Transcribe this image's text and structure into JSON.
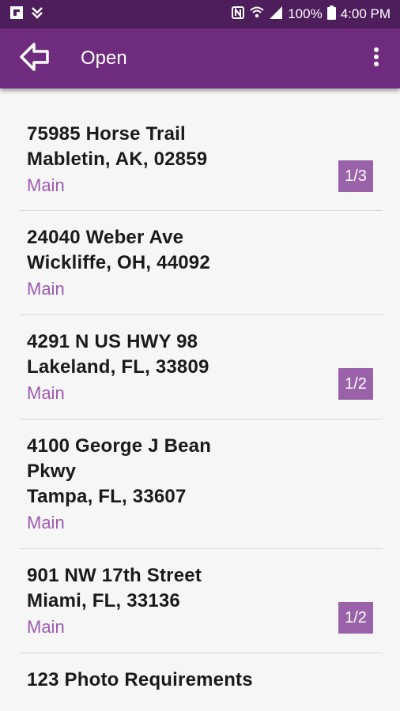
{
  "status_bar": {
    "battery": "100%",
    "time": "4:00 PM",
    "icons": [
      "flipboard-icon",
      "download-icon",
      "nfc-icon",
      "wifi-icon",
      "signal-icon",
      "battery-icon"
    ]
  },
  "app_bar": {
    "title": "Open",
    "back_icon": "back-arrow-icon",
    "menu_icon": "overflow-menu-icon"
  },
  "colors": {
    "status_bar": "#4e1d5c",
    "app_bar": "#6f2b7e",
    "accent_text": "#9c5aaf",
    "badge": "#9a62a9"
  },
  "items": [
    {
      "lines": [
        "75985 Horse Trail",
        "Mabletin, AK, 02859"
      ],
      "type": "Main",
      "badge": "1/3"
    },
    {
      "lines": [
        "24040 Weber Ave",
        "Wickliffe, OH, 44092"
      ],
      "type": "Main",
      "badge": ""
    },
    {
      "lines": [
        "4291 N US HWY 98",
        "Lakeland, FL, 33809"
      ],
      "type": "Main",
      "badge": "1/2"
    },
    {
      "lines": [
        "4100 George J Bean",
        "Pkwy",
        "Tampa, FL, 33607"
      ],
      "type": "Main",
      "badge": ""
    },
    {
      "lines": [
        "901 NW 17th Street",
        "Miami, FL, 33136"
      ],
      "type": "Main",
      "badge": "1/2"
    },
    {
      "lines": [
        "123 Photo Requirements"
      ],
      "type": "",
      "badge": ""
    }
  ]
}
